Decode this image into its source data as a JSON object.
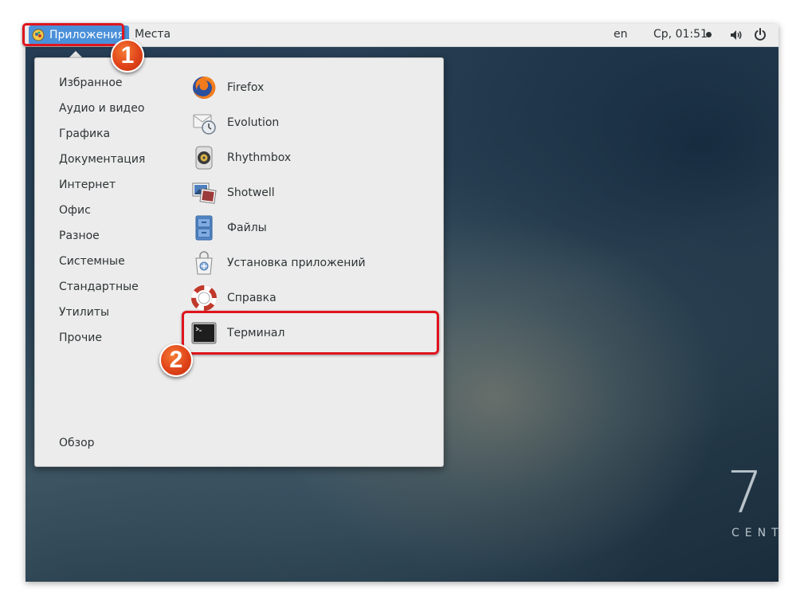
{
  "topbar": {
    "apps_label": "Приложения",
    "places_label": "Места",
    "language": "en",
    "clock": "Ср, 01:51",
    "volume_icon": "volume-icon",
    "power_icon": "power-icon"
  },
  "menu": {
    "categories": [
      {
        "label": "Избранное"
      },
      {
        "label": "Аудио и видео"
      },
      {
        "label": "Графика"
      },
      {
        "label": "Документация"
      },
      {
        "label": "Интернет"
      },
      {
        "label": "Офис"
      },
      {
        "label": "Разное"
      },
      {
        "label": "Системные"
      },
      {
        "label": "Стандартные"
      },
      {
        "label": "Утилиты"
      },
      {
        "label": "Прочие"
      }
    ],
    "overview_label": "Обзор",
    "apps": [
      {
        "label": "Firefox",
        "icon": "firefox-icon"
      },
      {
        "label": "Evolution",
        "icon": "evolution-icon"
      },
      {
        "label": "Rhythmbox",
        "icon": "rhythmbox-icon"
      },
      {
        "label": "Shotwell",
        "icon": "shotwell-icon"
      },
      {
        "label": "Файлы",
        "icon": "files-icon"
      },
      {
        "label": "Установка приложений",
        "icon": "software-install-icon"
      },
      {
        "label": "Справка",
        "icon": "help-icon"
      },
      {
        "label": "Терминал",
        "icon": "terminal-icon"
      }
    ]
  },
  "annotations": {
    "step1": "1",
    "step2": "2",
    "highlight_color": "#e0141e"
  },
  "desktop": {
    "logo_number": "7",
    "logo_text": "CENTOS"
  },
  "colors": {
    "topbar_bg": "#ededed",
    "active_menu": "#4a90d9",
    "menu_bg": "#ececec"
  }
}
